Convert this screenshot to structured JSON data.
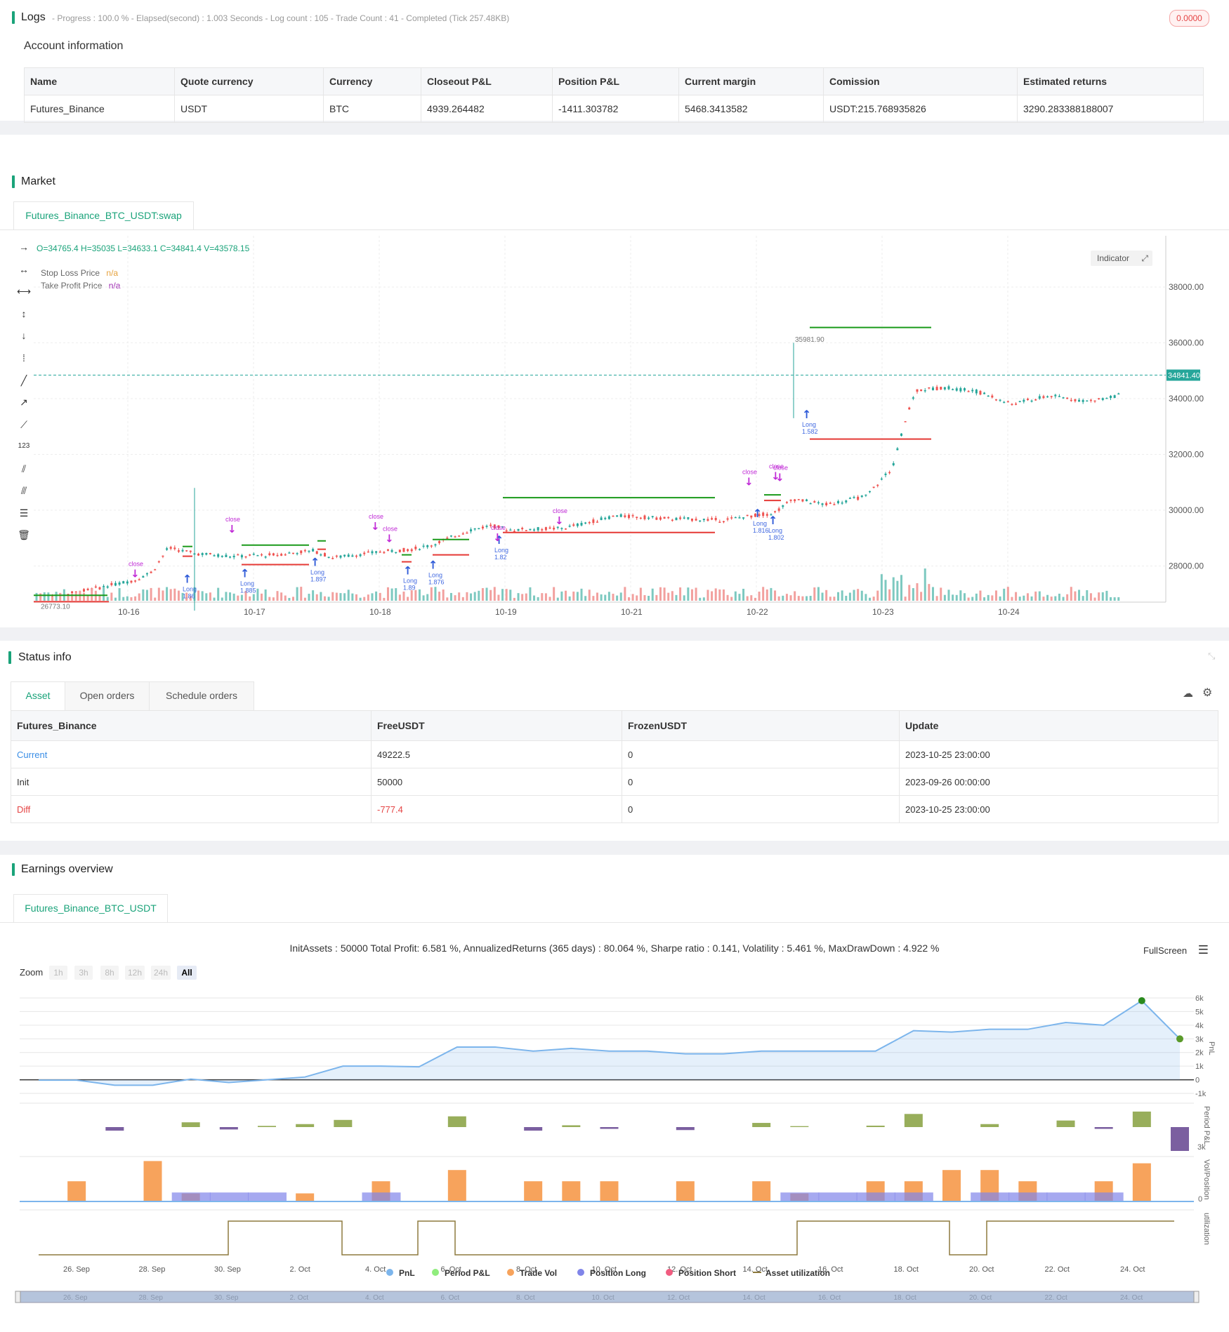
{
  "logs": {
    "title": "Logs",
    "status_line": "- Progress : 100.0 % - Elapsed(second) : 1.003  Seconds - Log count : 105 - Trade Count : 41 - Completed (Tick 257.48KB)",
    "badge": "0.0000"
  },
  "account": {
    "title": "Account information",
    "headers": [
      "Name",
      "Quote currency",
      "Currency",
      "Closeout P&L",
      "Position P&L",
      "Current margin",
      "Comission",
      "Estimated returns"
    ],
    "row": [
      "Futures_Binance",
      "USDT",
      "BTC",
      "4939.264482",
      "-1411.303782",
      "5468.3413582",
      "USDT:215.768935826",
      "3290.283388188007"
    ]
  },
  "market": {
    "title": "Market",
    "tab": "Futures_Binance_BTC_USDT:swap",
    "ohlcv": "O=34765.4 H=35035 L=34633.1 C=34841.4 V=43578.15",
    "legend": [
      {
        "name": "Stop Loss Price",
        "value": "n/a",
        "color": "#e6a23c"
      },
      {
        "name": "Take Profit Price",
        "value": "n/a",
        "color": "#9c27b0"
      }
    ],
    "indicator_button": "Indicator",
    "price_ticks": [
      "38000.00",
      "36000.00",
      "34000.00",
      "32000.00",
      "30000.00",
      "28000.00"
    ],
    "current_price": "34841.40",
    "high_marker": "35981.90",
    "low_marker": "26773.10",
    "date_ticks": [
      "10-16",
      "10-17",
      "10-18",
      "10-19",
      "10-21",
      "10-22",
      "10-23",
      "10-24"
    ],
    "tools": [
      "horizontal-ray-icon",
      "horizontal-line-icon",
      "extended-line-icon",
      "vertical-line-icon",
      "vertical-ray-icon",
      "vertical-segment-icon",
      "trend-line-icon",
      "ray-line-icon",
      "segment-icon",
      "price-label-icon",
      "parallel-channel-icon",
      "fib-channel-icon",
      "fib-retracement-icon",
      "trash-icon"
    ],
    "signals": {
      "long_labels": [
        "Long",
        "Long",
        "Long",
        "Long",
        "Long",
        "Long",
        "Long",
        "Long",
        "Long"
      ],
      "qty_labels": [
        "1.86",
        "1.885",
        "1.897",
        "1.89",
        "1.876",
        "1.82",
        "1.816",
        "1.802",
        "1.582"
      ],
      "close_label": "close"
    }
  },
  "status": {
    "title": "Status info",
    "tabs": [
      "Asset",
      "Open orders",
      "Schedule orders"
    ],
    "headers": [
      "Futures_Binance",
      "FreeUSDT",
      "FrozenUSDT",
      "Update"
    ],
    "rows": [
      [
        "Current",
        "49222.5",
        "0",
        "2023-10-25 23:00:00"
      ],
      [
        "Init",
        "50000",
        "0",
        "2023-09-26 00:00:00"
      ],
      [
        "Diff",
        "-777.4",
        "0",
        "2023-10-25 23:00:00"
      ]
    ]
  },
  "earnings": {
    "title": "Earnings overview",
    "tab": "Futures_Binance_BTC_USDT",
    "summary": "InitAssets : 50000 Total Profit: 6.581 %, AnnualizedReturns (365 days) : 80.064 %, Sharpe ratio : 0.141, Volatility : 5.461 %, MaxDrawDown : 4.922 %",
    "fullscreen": "FullScreen",
    "zoom_label": "Zoom",
    "zoom_buttons": [
      "1h",
      "3h",
      "8h",
      "12h",
      "24h",
      "All"
    ],
    "pnl_ticks": [
      "6k",
      "5k",
      "4k",
      "3k",
      "2k",
      "1k",
      "0",
      "-1k"
    ],
    "axis_titles": [
      "PnL",
      "Period P&L",
      "Vol/Position",
      "utilization"
    ],
    "period_tick": "3k",
    "vol_tick": "0",
    "dates": [
      "26. Sep",
      "28. Sep",
      "30. Sep",
      "2. Oct",
      "4. Oct",
      "6. Oct",
      "8. Oct",
      "10. Oct",
      "12. Oct",
      "14. Oct",
      "16. Oct",
      "18. Oct",
      "20. Oct",
      "22. Oct",
      "24. Oct"
    ],
    "legend": [
      {
        "name": "PnL",
        "color": "#7cb5ec"
      },
      {
        "name": "Period P&L",
        "color": "#90ed7d"
      },
      {
        "name": "Trade Vol",
        "color": "#f7a35c"
      },
      {
        "name": "Position Long",
        "color": "#8085e9"
      },
      {
        "name": "Position Short",
        "color": "#f15c80"
      },
      {
        "name": "Asset utilization",
        "color": "#8d7a3e"
      }
    ]
  },
  "chart_data": [
    {
      "type": "line",
      "title": "",
      "series": [
        {
          "name": "PnL",
          "values": [
            -30,
            -30,
            -400,
            -400,
            50,
            -200,
            0,
            200,
            1000,
            1000,
            950,
            2400,
            2400,
            2100,
            2300,
            2100,
            2100,
            1900,
            1900,
            2100,
            2100,
            2100,
            2100,
            3600,
            3500,
            3700,
            3700,
            4200,
            4000,
            5800,
            3000
          ]
        }
      ],
      "ylim": [
        -1000,
        6000
      ]
    },
    {
      "type": "bar",
      "series": [
        {
          "name": "Period P&L",
          "values": [
            0,
            0,
            -300,
            0,
            400,
            -200,
            100,
            250,
            600,
            0,
            0,
            900,
            0,
            -300,
            150,
            -150,
            0,
            -250,
            0,
            350,
            80,
            0,
            120,
            1100,
            0,
            250,
            0,
            550,
            -150,
            1300,
            -2000
          ]
        }
      ]
    },
    {
      "type": "bar",
      "series": [
        {
          "name": "Trade Vol",
          "values": [
            0,
            0.45,
            0,
            0.9,
            0.18,
            0,
            0,
            0.18,
            0,
            0.45,
            0,
            0.7,
            0,
            0.45,
            0.45,
            0.45,
            0,
            0.45,
            0,
            0.45,
            0.18,
            0,
            0.45,
            0.45,
            0.7,
            0.7,
            0.45,
            0,
            0.45,
            0.85,
            0
          ]
        },
        {
          "name": "Position Long",
          "values": [
            0,
            0,
            0,
            0,
            0.2,
            0.2,
            0.2,
            0,
            0,
            0.2,
            0,
            0,
            0,
            0,
            0,
            0,
            0,
            0,
            0,
            0,
            0.2,
            0.2,
            0.2,
            0.2,
            0,
            0.2,
            0.2,
            0.2,
            0.2,
            0,
            0
          ]
        }
      ]
    }
  ]
}
